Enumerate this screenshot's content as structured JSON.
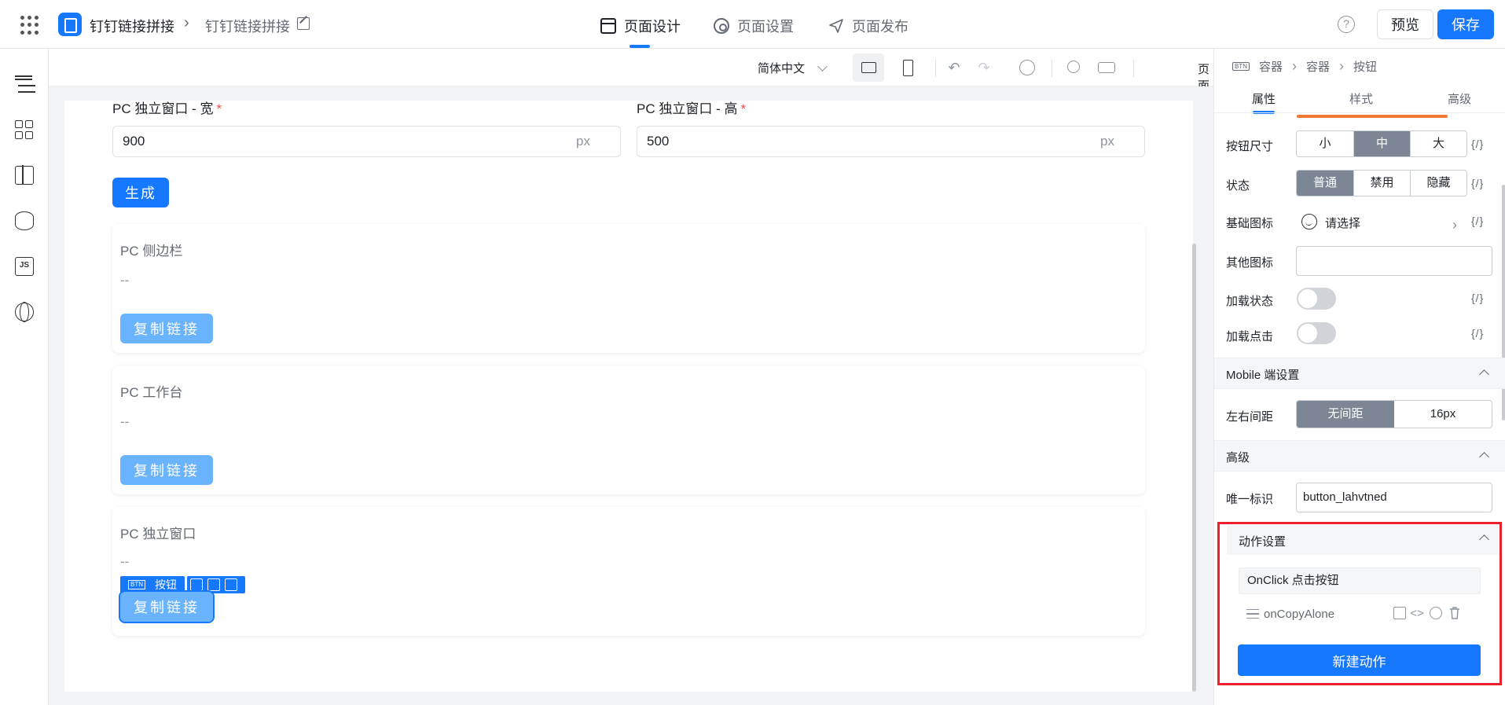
{
  "header": {
    "app_title": "钉钉链接拼接",
    "page_title": "钉钉链接拼接",
    "nav_tabs": [
      {
        "label": "页面设计",
        "active": true
      },
      {
        "label": "页面设置",
        "active": false
      },
      {
        "label": "页面发布",
        "active": false
      }
    ],
    "help_label": "?",
    "preview_label": "预览",
    "save_label": "保存"
  },
  "toolbar": {
    "language": "简体中文",
    "page_properties": "页面属性",
    "undo": "↶",
    "redo": "↷"
  },
  "canvas": {
    "width_field": {
      "label": "PC 独立窗口 - 宽",
      "required": "*",
      "value": "900",
      "suffix": "px"
    },
    "height_field": {
      "label": "PC 独立窗口 - 高",
      "required": "*",
      "value": "500",
      "suffix": "px"
    },
    "generate_label": "生成",
    "cards": [
      {
        "title": "PC 侧边栏",
        "value": "--",
        "button": "复制链接"
      },
      {
        "title": "PC 工作台",
        "value": "--",
        "button": "复制链接"
      },
      {
        "title": "PC 独立窗口",
        "value": "--",
        "button": "复制链接",
        "selected": true
      }
    ],
    "selection_tag": {
      "type_badge": "BTN",
      "label": "按钮"
    }
  },
  "panel": {
    "breadcrumb": {
      "badge": "BTN",
      "items": [
        "容器",
        "容器",
        "按钮"
      ]
    },
    "tabs": [
      {
        "label": "属性",
        "active": true
      },
      {
        "label": "样式",
        "active": false
      },
      {
        "label": "高级",
        "active": false
      }
    ],
    "expr_icon": "{/}",
    "button_size": {
      "label": "按钮尺寸",
      "options": [
        "小",
        "中",
        "大"
      ],
      "selected": "中"
    },
    "status": {
      "label": "状态",
      "options": [
        "普通",
        "禁用",
        "隐藏"
      ],
      "selected": "普通"
    },
    "base_icon": {
      "label": "基础图标",
      "placeholder": "请选择"
    },
    "other_icon": {
      "label": "其他图标",
      "value": ""
    },
    "loading_state": {
      "label": "加载状态",
      "on": false
    },
    "loading_click": {
      "label": "加载点击",
      "on": false
    },
    "mobile_section": {
      "title": "Mobile 端设置",
      "spacing": {
        "label": "左右间距",
        "options": [
          "无间距",
          "16px"
        ],
        "selected": "无间距"
      }
    },
    "advanced_section": {
      "title": "高级",
      "unique_id": {
        "label": "唯一标识",
        "value": "button_lahvtned"
      }
    },
    "action_section": {
      "title": "动作设置",
      "event": "OnClick 点击按钮",
      "actions": [
        {
          "name": "onCopyAlone"
        }
      ],
      "new_action_label": "新建动作"
    }
  },
  "colors": {
    "primary": "#1677ff",
    "highlight_border": "#e8212b",
    "segment_selected": "#7c8694",
    "accent_bar": "#f07833"
  }
}
